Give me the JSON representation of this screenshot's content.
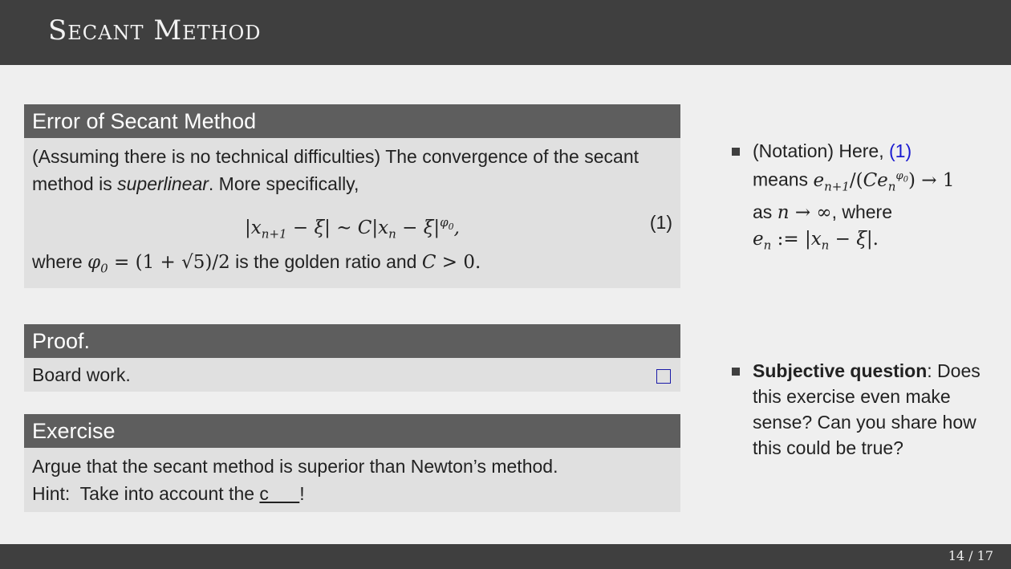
{
  "slide": {
    "title": "Secant Method",
    "page": "14 / 17"
  },
  "theorem": {
    "heading": "Error of Secant Method",
    "intro_1": "(Assuming there is no technical difficulties) The convergence of the secant method is ",
    "intro_em": "superlinear",
    "intro_2": ". More specifically,",
    "eq_number": "(1)",
    "after_1": "where ",
    "after_2": " is the golden ratio and "
  },
  "proof": {
    "heading": "Proof.",
    "body": "Board work."
  },
  "exercise": {
    "heading": "Exercise",
    "line1": "Argue that the secant method is superior than Newton’s method.",
    "hint_prefix": "Hint:  Take into account the ",
    "hint_blank": "c      ",
    "hint_suffix": "!"
  },
  "notes": {
    "notation_prefix": "(Notation) Here, ",
    "notation_ref": "(1)",
    "notation_means": "means ",
    "notation_as": "as ",
    "notation_where": ", where",
    "question_bold": "Subjective question",
    "question_rest": ": Does this exercise even make sense? Can you share how this could be true?"
  }
}
